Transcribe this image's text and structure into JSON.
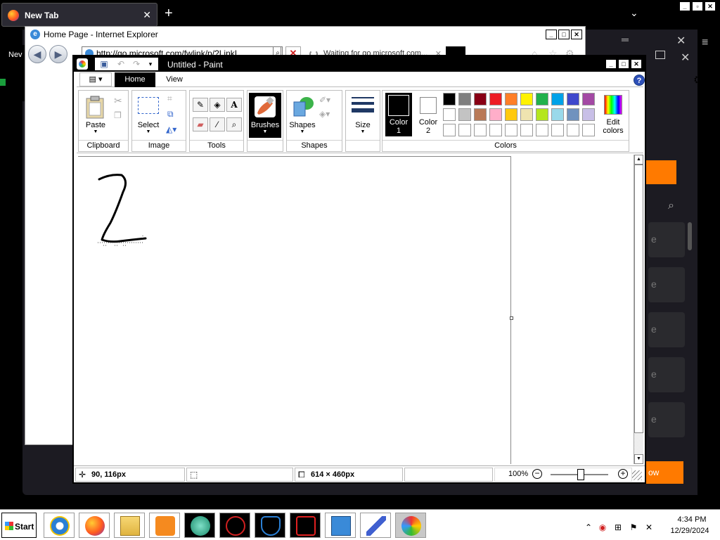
{
  "firefox": {
    "tab_title": "New Tab",
    "tab_close": "✕",
    "new_tab": "+",
    "list_tabs": "⌄",
    "left_tab_stub": "Nev",
    "right_panel_letters": [
      "e",
      "e",
      "e",
      "e",
      "e",
      "e"
    ],
    "right_button_text": "ow",
    "accent_color": "#ff7a00"
  },
  "ie": {
    "title": "Home Page - Internet Explorer",
    "address": "http://go.microsoft.com/fwlink/p/?LinkI",
    "tab_label": "Waiting for go.microsoft.com...",
    "tab_close": "✕",
    "back": "◀",
    "forward": "▶",
    "stop": "✕"
  },
  "paint": {
    "title": "Untitled - Paint",
    "menu_button": "▤ ▾",
    "tabs": [
      "Home",
      "View"
    ],
    "help": "?",
    "groups": {
      "clipboard": {
        "label": "Clipboard",
        "paste": "Paste"
      },
      "image": {
        "label": "Image",
        "select": "Select"
      },
      "tools": {
        "label": "Tools"
      },
      "brushes": {
        "label": "Brushes"
      },
      "shapes": {
        "label": "Shapes",
        "button": "Shapes"
      },
      "size": {
        "label": "Size"
      },
      "colors": {
        "label": "Colors",
        "color1_line1": "Color",
        "color1_line2": "1",
        "color2_line1": "Color",
        "color2_line2": "2",
        "edit_line1": "Edit",
        "edit_line2": "colors"
      }
    },
    "palette_row1": [
      "#000000",
      "#7f7f7f",
      "#880015",
      "#ed1c24",
      "#ff7f27",
      "#fff200",
      "#22b14c",
      "#00a2e8",
      "#3f48cc",
      "#a349a4"
    ],
    "palette_row2": [
      "#ffffff",
      "#c3c3c3",
      "#b97a57",
      "#ffaec9",
      "#ffc90e",
      "#efe4b0",
      "#b5e61d",
      "#99d9ea",
      "#7092be",
      "#c8bfe7"
    ],
    "palette_row3": [
      "#ffffff",
      "#ffffff",
      "#ffffff",
      "#ffffff",
      "#ffffff",
      "#ffffff",
      "#ffffff",
      "#ffffff",
      "#ffffff",
      "#ffffff"
    ],
    "status": {
      "cursor_pos": "90, 116px",
      "selection_size": "",
      "canvas_size": "614 × 460px",
      "file_size": "",
      "zoom": "100%"
    }
  },
  "taskbar": {
    "start": "Start",
    "time": "4:34 PM",
    "date": "12/29/2024"
  }
}
